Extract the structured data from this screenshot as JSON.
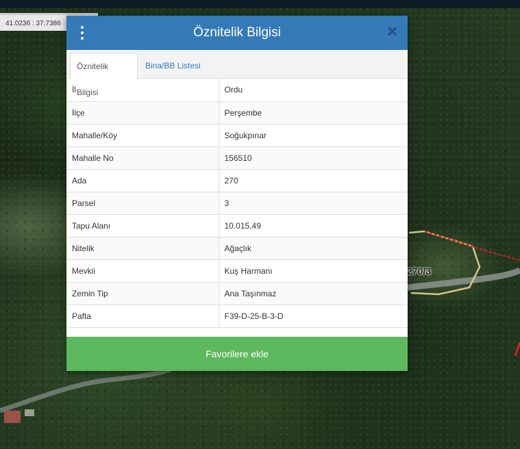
{
  "map": {
    "coordinates": "41.0236 : 37.7386",
    "parcel_label": "270/3"
  },
  "dialog": {
    "title": "Öznitelik Bilgisi",
    "tabs": [
      {
        "label": "Öznitelik Bilgisi",
        "active": true
      },
      {
        "label": "Bina/BB Listesi",
        "active": false
      }
    ],
    "rows": [
      {
        "key": "İl",
        "value": "Ordu"
      },
      {
        "key": "İlçe",
        "value": "Perşembe"
      },
      {
        "key": "Mahalle/Köy",
        "value": "Soğukpınar"
      },
      {
        "key": "Mahalle No",
        "value": "156510"
      },
      {
        "key": "Ada",
        "value": "270"
      },
      {
        "key": "Parsel",
        "value": "3"
      },
      {
        "key": "Tapu Alanı",
        "value": "10.015,49"
      },
      {
        "key": "Nitelik",
        "value": "Ağaçlık"
      },
      {
        "key": "Mevkii",
        "value": "Kuş Harmanı"
      },
      {
        "key": "Zemin Tip",
        "value": "Ana Taşınmaz"
      },
      {
        "key": "Pafta",
        "value": "F39-D-25-B-3-D"
      }
    ],
    "favorite_button": "Favorilere ekle"
  },
  "colors": {
    "header": "#337ab7",
    "button": "#5cb85c"
  }
}
